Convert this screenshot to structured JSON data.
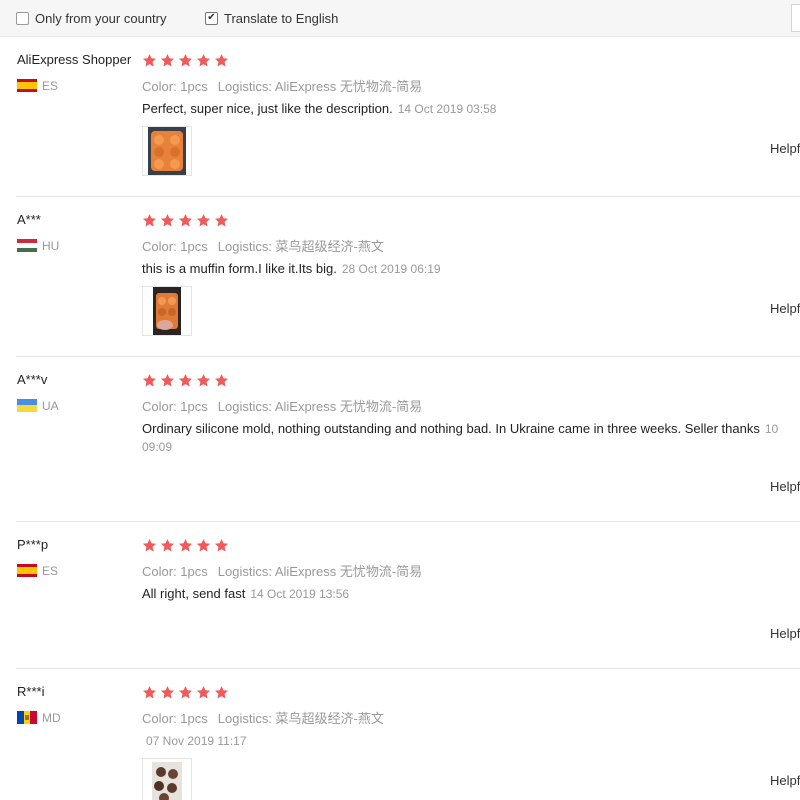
{
  "filters": {
    "only_country": {
      "label": "Only from your country",
      "checked": false
    },
    "translate": {
      "label": "Translate to English",
      "checked": true
    }
  },
  "colors": {
    "star": "#f05a5a",
    "muted": "#999999"
  },
  "helpful_label": "Helpful",
  "reviews": [
    {
      "name": "AliExpress Shopper",
      "country": "ES",
      "stars": 5,
      "color": "Color: 1pcs",
      "logistics": "Logistics: AliExpress 无忧物流-简易",
      "text": "Perfect, super nice, just like the description.",
      "date": "14 Oct 2019 03:58"
    },
    {
      "name": "A***",
      "country": "HU",
      "stars": 5,
      "color": "Color: 1pcs",
      "logistics": "Logistics: 菜鸟超级经济-燕文",
      "text": "this is a muffin form.I like it.Its big.",
      "date": "28 Oct 2019 06:19"
    },
    {
      "name": "A***v",
      "country": "UA",
      "stars": 5,
      "color": "Color: 1pcs",
      "logistics": "Logistics: AliExpress 无忧物流-简易",
      "text": "Ordinary silicone mold, nothing outstanding and nothing bad. In Ukraine came in three weeks. Seller thanks",
      "date_start": "10",
      "date_end": "09:09"
    },
    {
      "name": "P***p",
      "country": "ES",
      "stars": 5,
      "color": "Color: 1pcs",
      "logistics": "Logistics: AliExpress 无忧物流-简易",
      "text": "All right, send fast",
      "date": "14 Oct 2019 13:56"
    },
    {
      "name": "R***i",
      "country": "MD",
      "stars": 5,
      "color": "Color: 1pcs",
      "logistics": "Logistics: 菜鸟超级经济-燕文",
      "date": "07 Nov 2019 11:17"
    }
  ]
}
